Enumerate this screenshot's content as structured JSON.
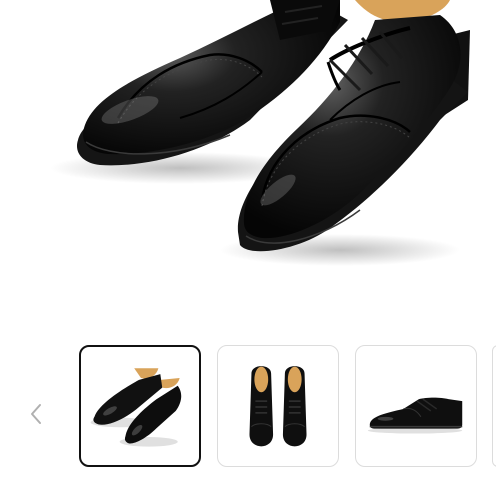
{
  "gallery": {
    "main_image": {
      "alt": "",
      "icon": "black-wingtip-brogue-pair-front-view"
    },
    "prev_button": {
      "icon": "chevron-left-icon"
    },
    "thumbnails": [
      {
        "icon": "shoe-pair-angled-view",
        "selected": true
      },
      {
        "icon": "shoe-pair-top-view",
        "selected": false
      },
      {
        "icon": "shoe-side-view",
        "selected": false
      }
    ],
    "colors": {
      "selected_border": "#111111",
      "thumb_border": "#dcdcdc",
      "arrow": "#b0b0b0",
      "leather": "#0d0d0d",
      "lining": "#d9a35a"
    }
  }
}
